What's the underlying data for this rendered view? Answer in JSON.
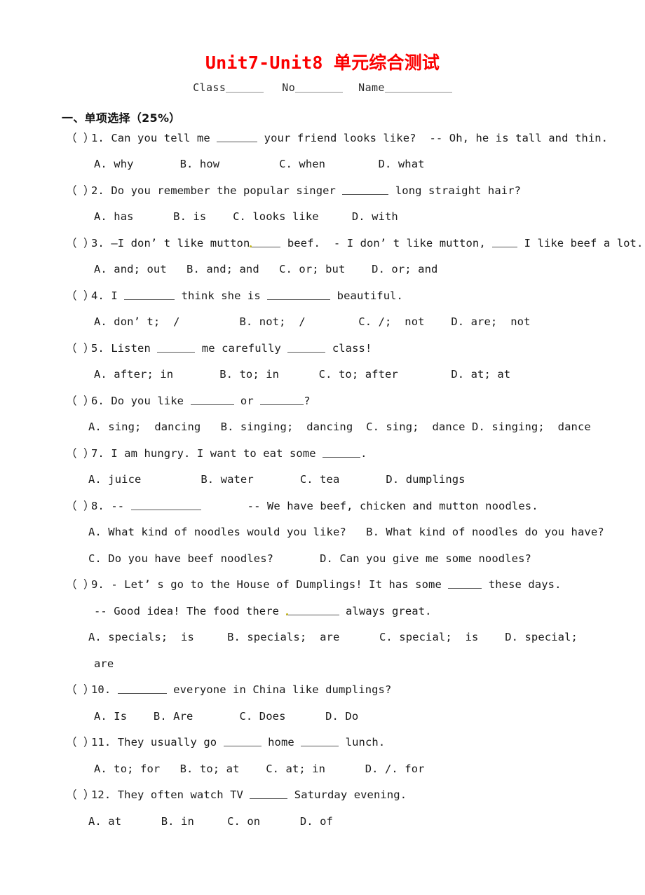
{
  "document": {
    "title": "Unit7-Unit8 单元综合测试",
    "title_color": "#fb0000",
    "id_line": {
      "class_label": "Class",
      "no_label": "No",
      "name_label": "Name"
    },
    "sections": [
      {
        "heading": "一、单项选择（25%）"
      }
    ]
  },
  "questions": [
    {
      "marker": "（ ）",
      "number": "1.",
      "stem_before": "Can you tell me ",
      "stem_after": " your friend looks like?  -- Oh, he is tall and thin.",
      "options_line1": "A. why       B. how         C. when        D. what"
    },
    {
      "marker": "（ ）",
      "number": "2.",
      "stem_before": "Do you remember the popular singer ",
      "stem_after": " long straight hair?",
      "options_line1": "A. has      B. is    C. looks like     D. with"
    },
    {
      "marker": "（ ）",
      "number": "3.",
      "stem_before": "—I don’ t like mutton",
      "stem_mid": " beef.  - I don’ t like mutton, ",
      "stem_after": " I like beef a lot.",
      "options_line1": "A. and; out   B. and; and   C. or; but    D. or; and"
    },
    {
      "marker": "（ ）",
      "number": "4.",
      "stem_before": "I ",
      "stem_mid": " think she is ",
      "stem_after": " beautiful.",
      "options_line1": "A. don’ t;  /         B. not;  /        C. /;  not    D. are;  not"
    },
    {
      "marker": "（ ）",
      "number": "5.",
      "stem_before": "Listen ",
      "stem_mid": " me carefully ",
      "stem_after": " class!",
      "options_line1": "A. after; in       B. to; in      C. to; after        D. at; at"
    },
    {
      "marker": "（ ）",
      "number": "6.",
      "stem_before": "Do you like ",
      "stem_mid": " or ",
      "stem_after": "?",
      "options_line1": "A. sing;  dancing   B. singing;  dancing  C. sing;  dance D. singing;  dance"
    },
    {
      "marker": "（ ）",
      "number": "7.",
      "stem_before": "I am hungry. I want to eat some ",
      "stem_after": ".",
      "options_line1": "A. juice         B. water       C. tea       D. dumplings"
    },
    {
      "marker": "（ ）",
      "number": "8.",
      "stem_before": "-- ",
      "stem_after": "       -- We have beef, chicken and mutton noodles.",
      "options_line1": "A. What kind of noodles would you like?   B. What kind of noodles do you have?",
      "options_line2": "C. Do you have beef noodles?       D. Can you give me some noodles?"
    },
    {
      "marker": "（ ）",
      "number": "9.",
      "stem_before": "- Let’ s go to the House of Dumplings! It has some ",
      "stem_after": " these days.",
      "continuation_before": "-- Good idea! The food there ",
      "continuation_after": " always great.",
      "options_line1": "A. specials;  is     B. specials;  are      C. special;  is    D. special;",
      "options_wrap": "are"
    },
    {
      "marker": "（ ）",
      "number": "10.",
      "stem_before": "",
      "stem_after": " everyone in China like dumplings?",
      "options_line1": "A. Is    B. Are       C. Does      D. Do"
    },
    {
      "marker": "（ ）",
      "number": "11.",
      "stem_before": "They usually go ",
      "stem_mid": " home ",
      "stem_after": " lunch.",
      "options_line1": "A. to; for   B. to; at    C. at; in      D. /. for"
    },
    {
      "marker": "（ ）",
      "number": "12.",
      "stem_before": "They often watch TV ",
      "stem_after": " Saturday evening.",
      "options_line1": "A. at      B. in     C. on      D. of"
    }
  ]
}
